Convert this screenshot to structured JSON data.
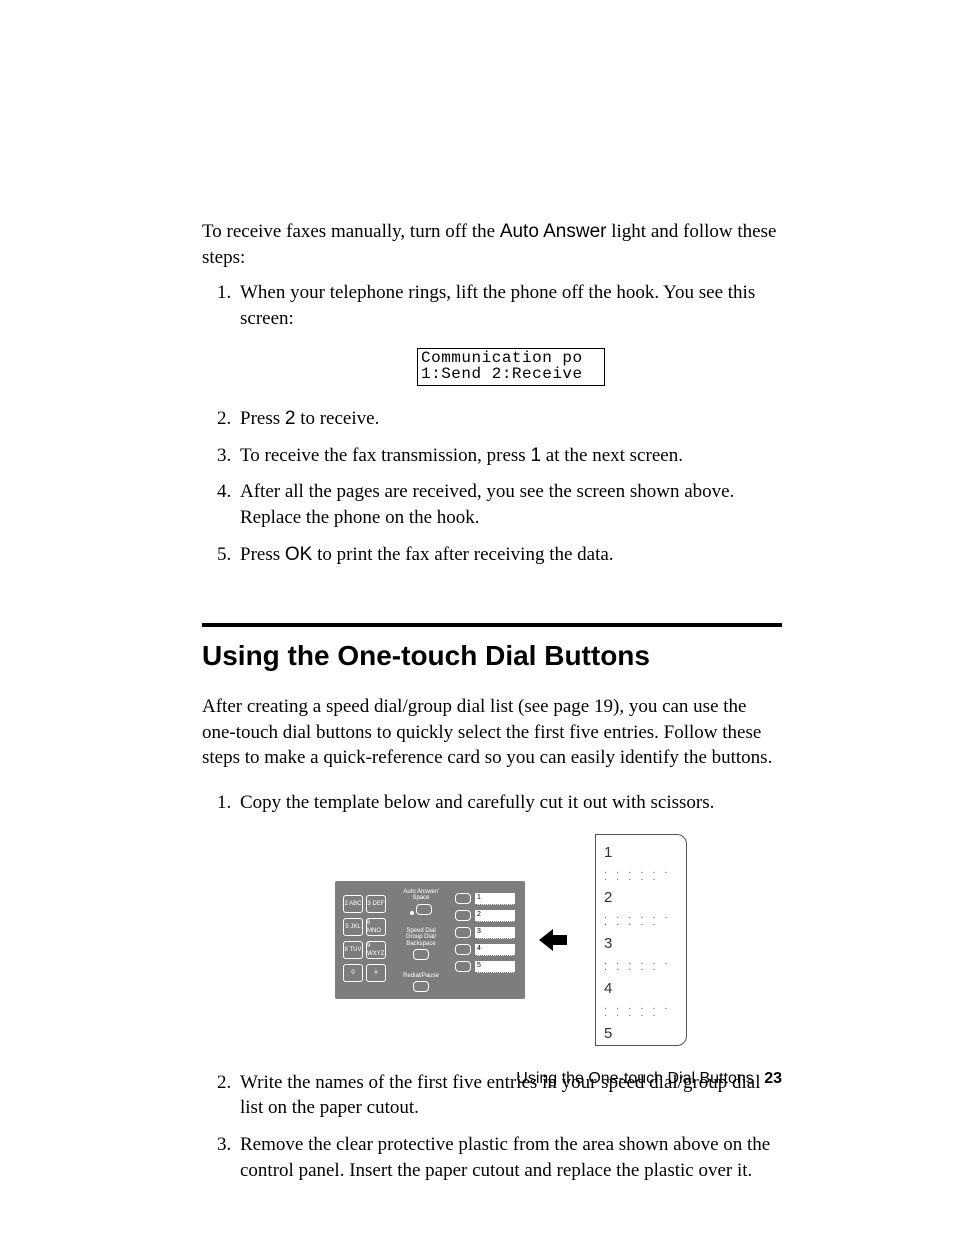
{
  "intro1_a": "To receive faxes manually, turn off the ",
  "intro1_b": "Auto Answer",
  "intro1_c": " light and follow these steps:",
  "steps_a": {
    "s1": "When your telephone rings, lift the phone off the hook. You see this screen:",
    "lcd_line1": "Communication po",
    "lcd_line2": "1:Send 2:Receive",
    "s2_a": "Press ",
    "s2_b": "2",
    "s2_c": " to receive.",
    "s3_a": "To receive the fax transmission, press ",
    "s3_b": "1",
    "s3_c": " at the next screen.",
    "s4": "After all the pages are received, you see the screen shown above. Replace the phone on the hook.",
    "s5_a": "Press ",
    "s5_b": "OK",
    "s5_c": " to print the fax after receiving the data."
  },
  "heading": "Using the One-touch Dial Buttons",
  "para2": "After creating a speed dial/group dial list (see page 19), you can use the one-touch dial buttons to quickly select the first five entries. Follow these steps to make a quick-reference card so you can easily identify the buttons.",
  "steps_b": {
    "s1": "Copy the template below and carefully cut it out with scissors.",
    "s2": "Write the names of the first five entries in your speed dial/group dial list on the paper cutout.",
    "s3": "Remove the clear protective plastic from the area shown above on the control panel. Insert the paper cutout and replace the plastic over it."
  },
  "panel": {
    "keys": [
      "2 ABC",
      "3 DEF",
      "5 JKL",
      "6 MNO",
      "8 TUV",
      "9 WXYZ",
      "0",
      "#"
    ],
    "label1": "Auto Answer/\nSpace",
    "label2": "Speed Dial\nGroup Dial/\nBackspace",
    "label3": "Redial/Pause",
    "ot": [
      "1",
      "2",
      "3",
      "4",
      "5"
    ]
  },
  "card": {
    "nums": [
      "1",
      "2",
      "3",
      "4",
      "5"
    ],
    "dots": ". . . . . . . . . . ."
  },
  "footer_text": "Using the One-touch Dial Buttons",
  "footer_page": "23"
}
